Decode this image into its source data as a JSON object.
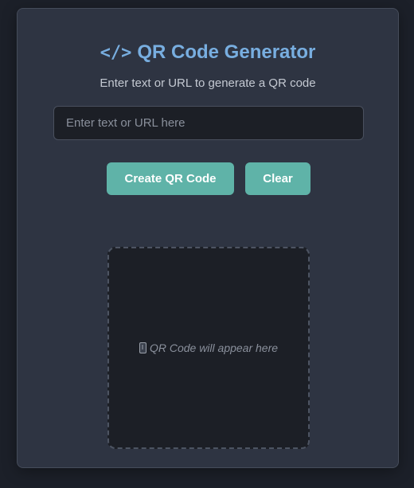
{
  "header": {
    "code_glyph": "</>",
    "title": "QR Code Generator",
    "subtitle": "Enter text or URL to generate a QR code"
  },
  "input": {
    "value": "",
    "placeholder": "Enter text or URL here"
  },
  "buttons": {
    "create_label": "Create QR Code",
    "clear_label": "Clear"
  },
  "qr_output": {
    "icon": "mobile-phone-icon",
    "placeholder_text": "QR Code will appear here"
  },
  "colors": {
    "page_background": "#1c2029",
    "card_background": "#2e3442",
    "accent_title": "#78aee0",
    "button_background": "#5fb3a8",
    "input_background": "#1c1f26"
  }
}
